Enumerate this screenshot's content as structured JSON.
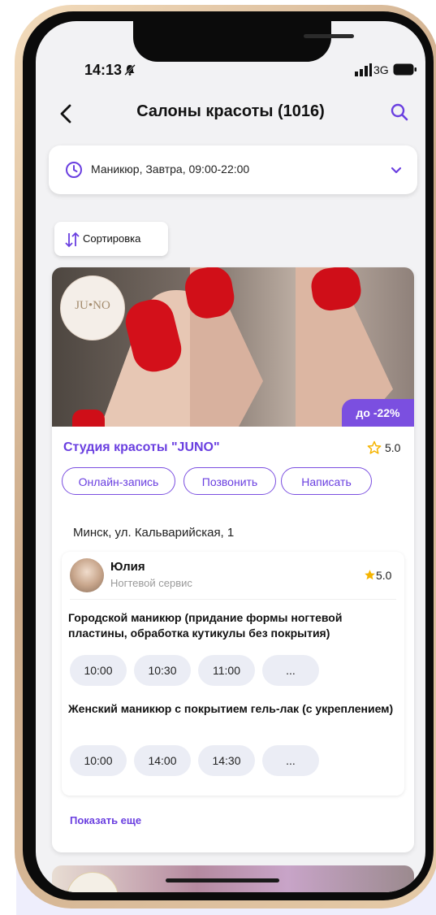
{
  "status_bar": {
    "time": "14:13",
    "network": "3G"
  },
  "header": {
    "title": "Салоны красоты (1016)"
  },
  "filter": {
    "text": "Маникюр, Завтра, 09:00-22:00"
  },
  "sort": {
    "label": "Сортировка"
  },
  "salon": {
    "logo_text": "JU•NO",
    "discount": "до -22%",
    "name": "Студия красоты \"JUNO\"",
    "rating": "5.0",
    "actions": {
      "book": "Онлайн-запись",
      "call": "Позвонить",
      "message": "Написать"
    },
    "address": "Минск, ул. Кальварийская, 1",
    "master": {
      "name": "Юлия",
      "role": "Ногтевой сервис",
      "rating": "5.0"
    },
    "services": [
      {
        "title": "Городской маникюр (придание формы ногтевой пластины, обработка кутикулы без покрытия)",
        "slots": [
          "10:00",
          "10:30",
          "11:00",
          "..."
        ]
      },
      {
        "title": "Женский маникюр с покрытием гель-лак (с укреплением)",
        "slots": [
          "10:00",
          "14:00",
          "14:30",
          "..."
        ]
      }
    ],
    "show_more": "Показать еще"
  },
  "colors": {
    "accent": "#7b4fe0",
    "star": "#f5b400"
  }
}
